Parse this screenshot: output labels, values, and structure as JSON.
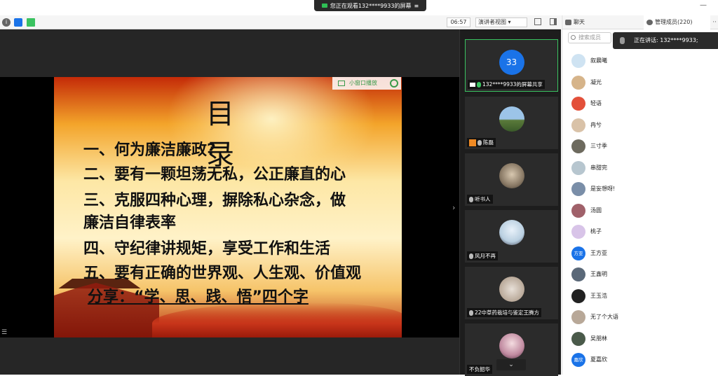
{
  "banner": {
    "text": "您正在观看132****9933的屏幕",
    "min_glyph": "—"
  },
  "toolbar": {
    "timer": "06:57",
    "view_label": "演讲者视图 ▾",
    "icons": [
      "info-icon",
      "shield-icon",
      "signal-icon",
      "fullscreen-icon",
      "layout-icon"
    ]
  },
  "slide": {
    "title": "目 录",
    "lines": [
      "一、何为廉洁廉政?",
      "二、要有一颗坦荡无私，公正廉直的心",
      "三、克服四种心理，摒除私心杂念，做",
      "廉洁自律表率",
      "四、守纪律讲规矩，享受工作和生活",
      "五、要有正确的世界观、人生观、价值观",
      "分享：“学、思、践、悟”四个字"
    ],
    "small_window_label": "小窗口播放"
  },
  "video_tiles": [
    {
      "name": "132****9933的屏幕共享",
      "avatar_text": "33",
      "active": true,
      "mic": "on"
    },
    {
      "name": "陈磊",
      "avatar_text": "",
      "active": false,
      "mic": "off"
    },
    {
      "name": "听书人",
      "avatar_text": "",
      "active": false,
      "mic": "off"
    },
    {
      "name": "风月不再",
      "avatar_text": "",
      "active": false,
      "mic": "off"
    },
    {
      "name": "22中草药栽培与鉴定王腾方",
      "avatar_text": "",
      "active": false,
      "mic": "off"
    },
    {
      "name": "不负韶华",
      "avatar_text": "",
      "active": false,
      "mic": "off"
    }
  ],
  "video_col": {
    "up_glyph": "▲",
    "down_glyph": "⌄"
  },
  "right_panel": {
    "tab_chat": "聊天",
    "tab_members": "管理成员(220)",
    "more_glyph": "··",
    "search_placeholder": "搜索成员",
    "speaking": "正在讲话: 132****9933;",
    "members": [
      {
        "name": "叙晨曦",
        "avatar_text": ""
      },
      {
        "name": "凝光",
        "avatar_text": ""
      },
      {
        "name": "轻语",
        "avatar_text": ""
      },
      {
        "name": "冉兮",
        "avatar_text": ""
      },
      {
        "name": "三寸季",
        "avatar_text": ""
      },
      {
        "name": "串甜完",
        "avatar_text": ""
      },
      {
        "name": "是妄想呀!",
        "avatar_text": ""
      },
      {
        "name": "汤圆",
        "avatar_text": ""
      },
      {
        "name": "桃子",
        "avatar_text": ""
      },
      {
        "name": "王方亚",
        "avatar_text": "方亚"
      },
      {
        "name": "王鑫明",
        "avatar_text": ""
      },
      {
        "name": "王玉浩",
        "avatar_text": ""
      },
      {
        "name": "无了个大语",
        "avatar_text": ""
      },
      {
        "name": "吴朋林",
        "avatar_text": ""
      },
      {
        "name": "夏嘉欣",
        "avatar_text": "嘉欣"
      }
    ]
  },
  "colors": {
    "accent_green": "#3ac260",
    "accent_blue": "#1a73e8",
    "stage_bg": "#262626"
  }
}
